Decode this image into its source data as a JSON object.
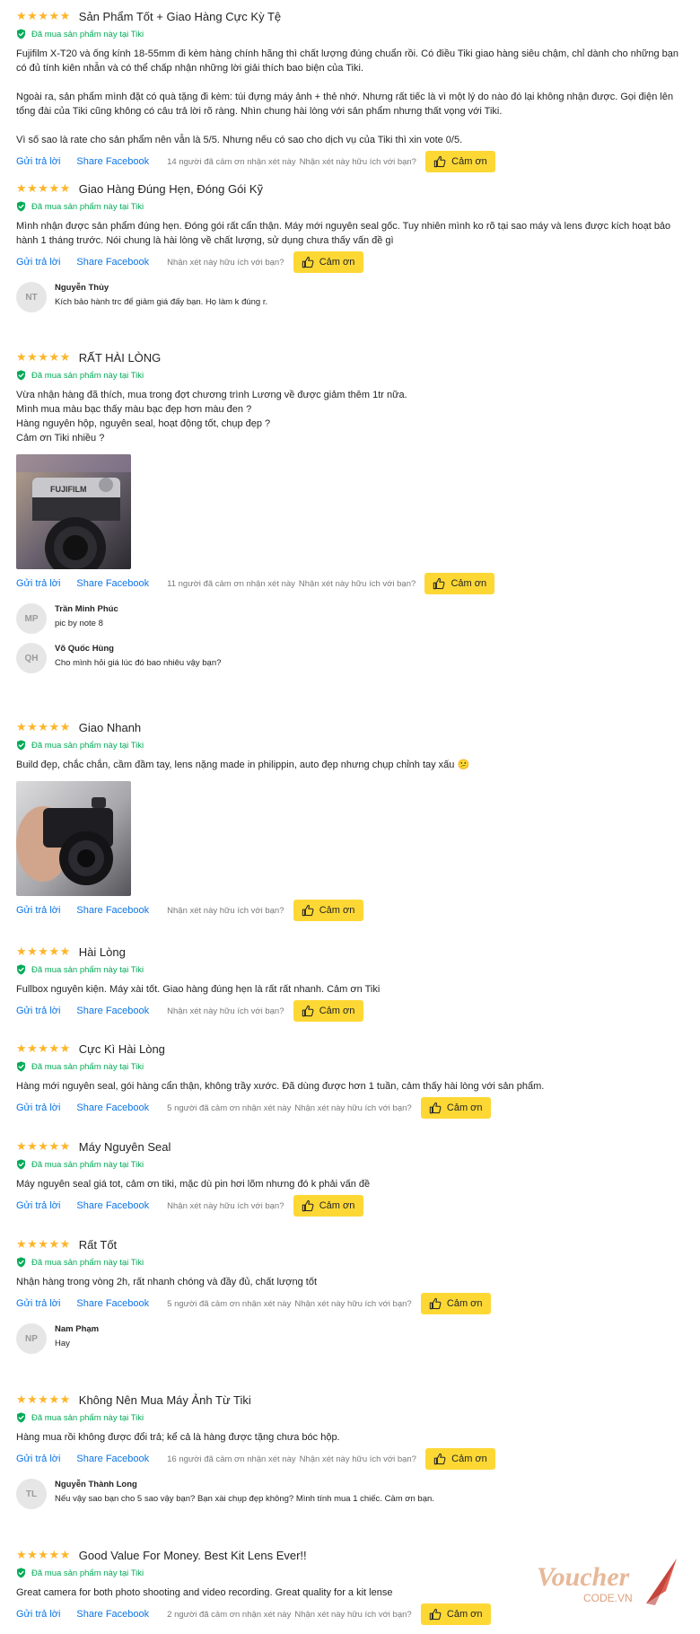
{
  "common": {
    "stars": "★★★★★",
    "verified": "Đã mua sản phẩm này tại Tiki",
    "reply": "Gửi trả lời",
    "share": "Share Facebook",
    "helpful": "Nhận xét này hữu ích với bạn?",
    "thanks": "Cảm ơn"
  },
  "colors": {
    "star": "#fdb528",
    "verified": "#00ab56",
    "link": "#0b74e5",
    "button": "#fdd835"
  },
  "reviews": [
    {
      "title": "Sản Phẩm Tốt + Giao Hàng Cực Kỳ Tệ",
      "body": "Fujifilm X-T20 và ống kính 18-55mm đi kèm hàng chính hãng thì chất lượng đúng chuẩn rồi. Có điều Tiki giao hàng siêu chậm, chỉ dành cho những bạn có đủ tính kiên nhẫn và có thể chấp nhận những lời giải thích bao biện của Tiki.\n\nNgoài ra, sản phẩm mình đặt có quà tặng đi kèm: túi đựng máy ảnh + thẻ nhớ. Nhưng rất tiếc là vì một lý do nào đó lại không nhận được. Gọi điện lên tổng đài của Tiki cũng không có câu trả lời rõ ràng. Nhìn chung hài lòng với sản phẩm nhưng thất vọng với Tiki.\n\nVì số sao là rate cho sản phẩm nên vẫn là 5/5. Nhưng nếu có sao cho dịch vụ của Tiki thì xin vote 0/5.",
      "thanked": "14 người đã cảm ơn nhận xét này"
    },
    {
      "title": "Giao Hàng Đúng Hẹn, Đóng Gói Kỹ",
      "body": "Mình nhận được sản phẩm đúng hẹn. Đóng gói rất cẩn thận. Máy mới nguyên seal gốc. Tuy nhiên mình ko rõ tại sao máy và lens được kích hoạt bảo hành 1 tháng trước. Nói chung là hài lòng về chất lượng, sử dụng chưa thấy vấn đề gì",
      "comments": [
        {
          "initials": "NT",
          "name": "Nguyễn Thủy",
          "text": "Kích bảo hành trc để giảm giá đấy bạn. Họ làm k đúng r."
        }
      ]
    },
    {
      "title": "RẤT HÀI LÒNG",
      "body": "Vừa nhận hàng đã thích, mua trong đợt chương trình Lương về được giảm thêm 1tr nữa.\nMình mua màu bạc thấy màu bạc đẹp hơn màu đen ?\nHàng nguyên hộp, nguyên seal, hoạt động tốt, chụp đẹp ?\nCảm ơn Tiki nhiều ?",
      "thanked": "11 người đã cảm ơn nhận xét này",
      "comments": [
        {
          "initials": "MP",
          "name": "Trần Minh Phúc",
          "text": "pic by note 8"
        },
        {
          "initials": "QH",
          "name": "Võ Quốc Hùng",
          "text": "Cho mình hỏi giá lúc đó bao nhiêu vậy bạn?"
        }
      ]
    },
    {
      "title": "Giao Nhanh",
      "body": "Build đẹp, chắc chắn, cầm đầm tay, lens nặng made in philippin, auto đẹp nhưng chụp chỉnh tay xấu 😕"
    },
    {
      "title": "Hài Lòng",
      "body": "Fullbox nguyên kiện. Máy xài tốt. Giao hàng đúng hẹn là rất rất nhanh. Cảm ơn Tiki"
    },
    {
      "title": "Cực Kì Hài Lòng",
      "body": "Hàng mới nguyên seal, gói hàng cẩn thận, không trầy xước. Đã dùng được hơn 1 tuần, cảm thấy hài lòng với sản phẩm.",
      "thanked": "5 người đã cảm ơn nhận xét này"
    },
    {
      "title": "Máy Nguyên Seal",
      "body": "Máy nguyên seal giá tot, cảm ơn tiki, mặc dù pin hơi lõm nhưng đó k phải vấn đề"
    },
    {
      "title": "Rất Tốt",
      "body": "Nhận hàng trong vòng 2h, rất nhanh chóng và đầy đủ, chất lượng tốt",
      "thanked": "5 người đã cảm ơn nhận xét này",
      "comments": [
        {
          "initials": "NP",
          "name": "Nam Phạm",
          "text": "Hay"
        }
      ]
    },
    {
      "title": "Không Nên Mua Máy Ảnh Từ Tiki",
      "body": "Hàng mua rồi không được đổi trả; kể cả là hàng được tặng chưa bóc hộp.",
      "thanked": "16 người đã cảm ơn nhận xét này",
      "comments": [
        {
          "initials": "TL",
          "name": "Nguyễn Thành Long",
          "text": "Nếu vậy sao bạn cho 5 sao vậy bạn? Bạn xài chụp đẹp không? Mình tính mua 1 chiếc. Cảm ơn bạn."
        }
      ]
    },
    {
      "title": "Good Value For Money. Best Kit Lens Ever!!",
      "body": "Great camera for both photo shooting and video recording. Great quality for a kit lense",
      "thanked": "2 người đã cảm ơn nhận xét này"
    }
  ],
  "watermark": {
    "line1": "Voucher",
    "line2": "CODE.VN"
  }
}
